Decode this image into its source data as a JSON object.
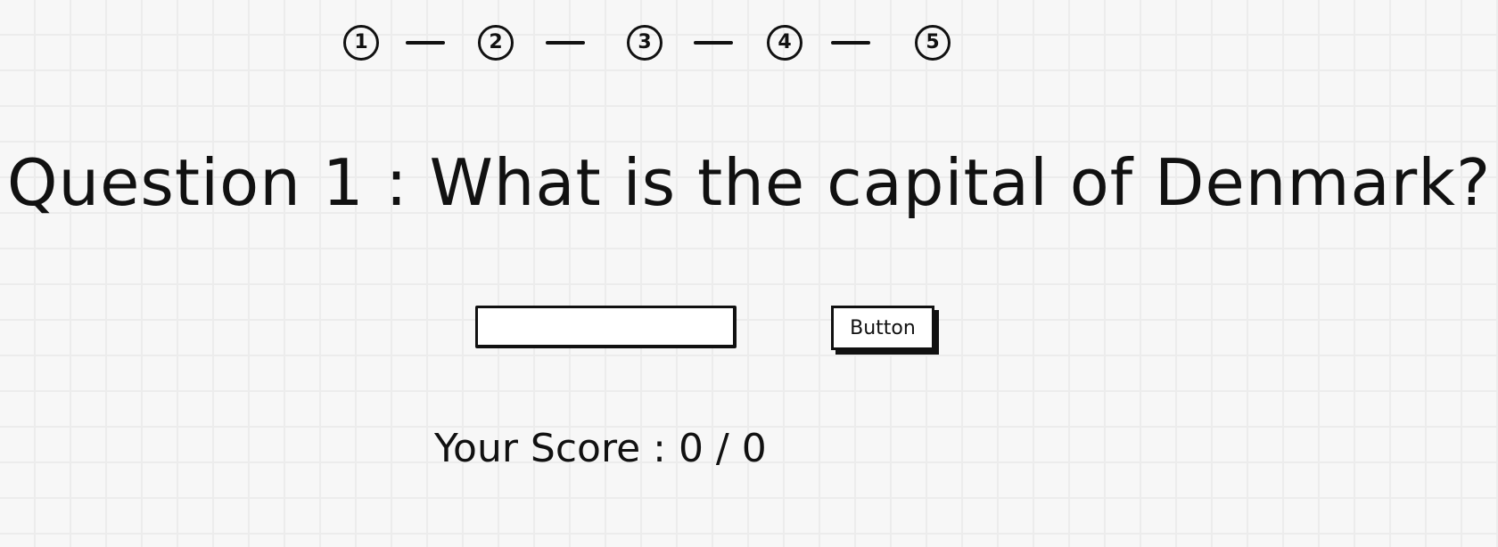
{
  "stepper": {
    "steps": [
      "1",
      "2",
      "3",
      "4",
      "5"
    ]
  },
  "question": {
    "text": "Question 1 : What is the capital of Denmark?"
  },
  "answer": {
    "value": "",
    "placeholder": ""
  },
  "submit": {
    "label": "Button"
  },
  "score": {
    "text": "Your Score : 0 / 0"
  }
}
